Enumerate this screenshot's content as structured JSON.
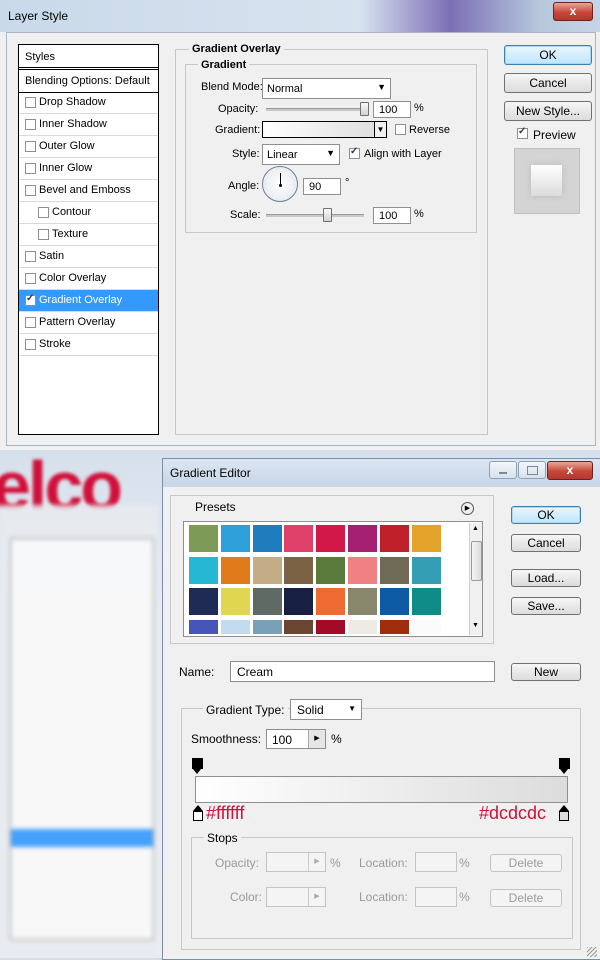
{
  "layer_style": {
    "title": "Layer Style",
    "styles_header": "Styles",
    "blending_label": "Blending Options: Default",
    "styles": [
      {
        "label": "Drop Shadow",
        "checked": false
      },
      {
        "label": "Inner Shadow",
        "checked": false
      },
      {
        "label": "Outer Glow",
        "checked": false
      },
      {
        "label": "Inner Glow",
        "checked": false
      },
      {
        "label": "Bevel and Emboss",
        "checked": false
      },
      {
        "label": "Contour",
        "checked": false
      },
      {
        "label": "Texture",
        "checked": false
      },
      {
        "label": "Satin",
        "checked": false
      },
      {
        "label": "Color Overlay",
        "checked": false
      },
      {
        "label": "Gradient Overlay",
        "checked": true
      },
      {
        "label": "Pattern Overlay",
        "checked": false
      },
      {
        "label": "Stroke",
        "checked": false
      }
    ],
    "panel_title": "Gradient Overlay",
    "group_title": "Gradient",
    "blend_mode_label": "Blend Mode:",
    "blend_mode_value": "Normal",
    "opacity_label": "Opacity:",
    "opacity_value": "100",
    "percent": "%",
    "gradient_label": "Gradient:",
    "reverse_label": "Reverse",
    "reverse_checked": false,
    "style_label": "Style:",
    "style_value": "Linear",
    "align_label": "Align with Layer",
    "align_checked": true,
    "angle_label": "Angle:",
    "angle_value": "90",
    "degree": "°",
    "scale_label": "Scale:",
    "scale_value": "100",
    "ok_label": "OK",
    "cancel_label": "Cancel",
    "new_style_label": "New Style...",
    "preview_label": "Preview",
    "preview_checked": true,
    "close_label": "x"
  },
  "background": {
    "logo_text": "elco"
  },
  "gradient_editor": {
    "title": "Gradient Editor",
    "presets_label": "Presets",
    "ok_label": "OK",
    "cancel_label": "Cancel",
    "load_label": "Load...",
    "save_label": "Save...",
    "name_label": "Name:",
    "name_value": "Cream",
    "new_label": "New",
    "gradient_type_label": "Gradient Type:",
    "gradient_type_value": "Solid",
    "smoothness_label": "Smoothness:",
    "smoothness_value": "100",
    "percent": "%",
    "left_color_hex": "#ffffff",
    "right_color_hex": "#dcdcdc",
    "stops_label": "Stops",
    "opacity_label": "Opacity:",
    "location_label": "Location:",
    "color_label": "Color:",
    "delete_label": "Delete",
    "swatches": [
      "#7e9a57",
      "#2e9fd8",
      "#1f7cbd",
      "#e0416a",
      "#d11848",
      "#a52070",
      "#c0202a",
      "#e3a32a",
      "#25b7d4",
      "#e07a1a",
      "#c4ad86",
      "#7c6244",
      "#5a7a3b",
      "#f08082",
      "#6f6a55",
      "#349fb4",
      "#1f2a55",
      "#e1d650",
      "#5f6a65",
      "#182041",
      "#f06a34",
      "#88876c",
      "#0d5aa5",
      "#0f8c88",
      "#4754b8",
      "#c4dbef",
      "#7aa0b7",
      "#6a4532",
      "#a30a25",
      "#eeeae6",
      "#a02d0e",
      "#fbfbfb"
    ]
  }
}
